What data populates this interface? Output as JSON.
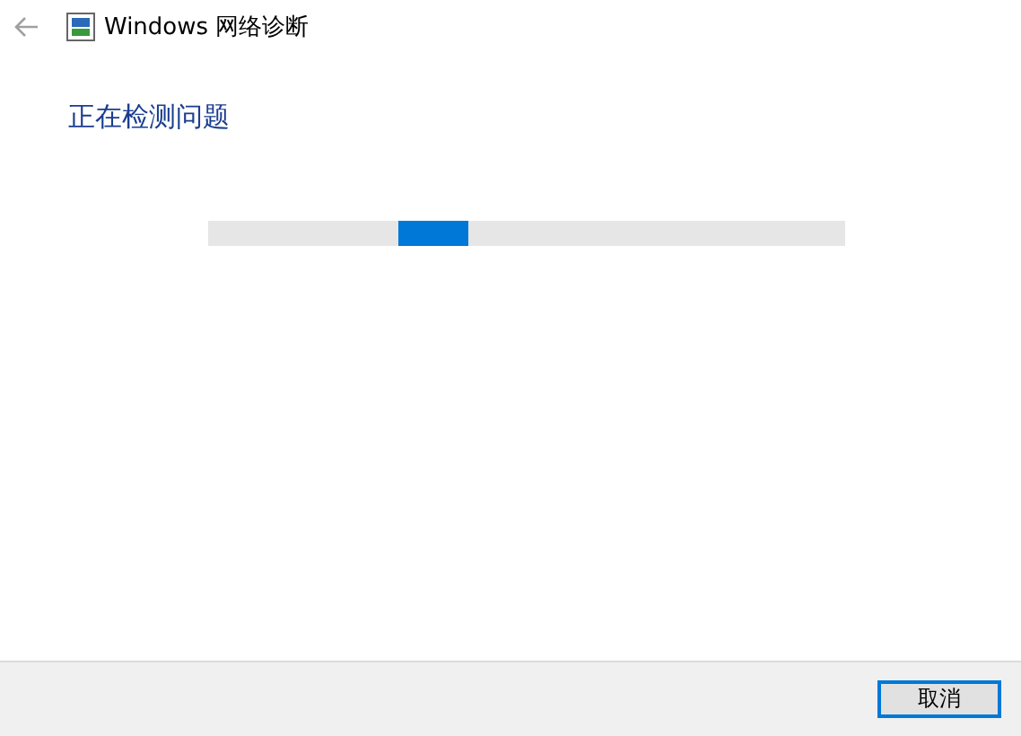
{
  "window": {
    "title": "Windows 网络诊断"
  },
  "heading": "正在检测问题",
  "progress": {
    "indeterminate": true
  },
  "footer": {
    "buttons": [
      {
        "label": "取消",
        "kind": "default"
      }
    ]
  }
}
